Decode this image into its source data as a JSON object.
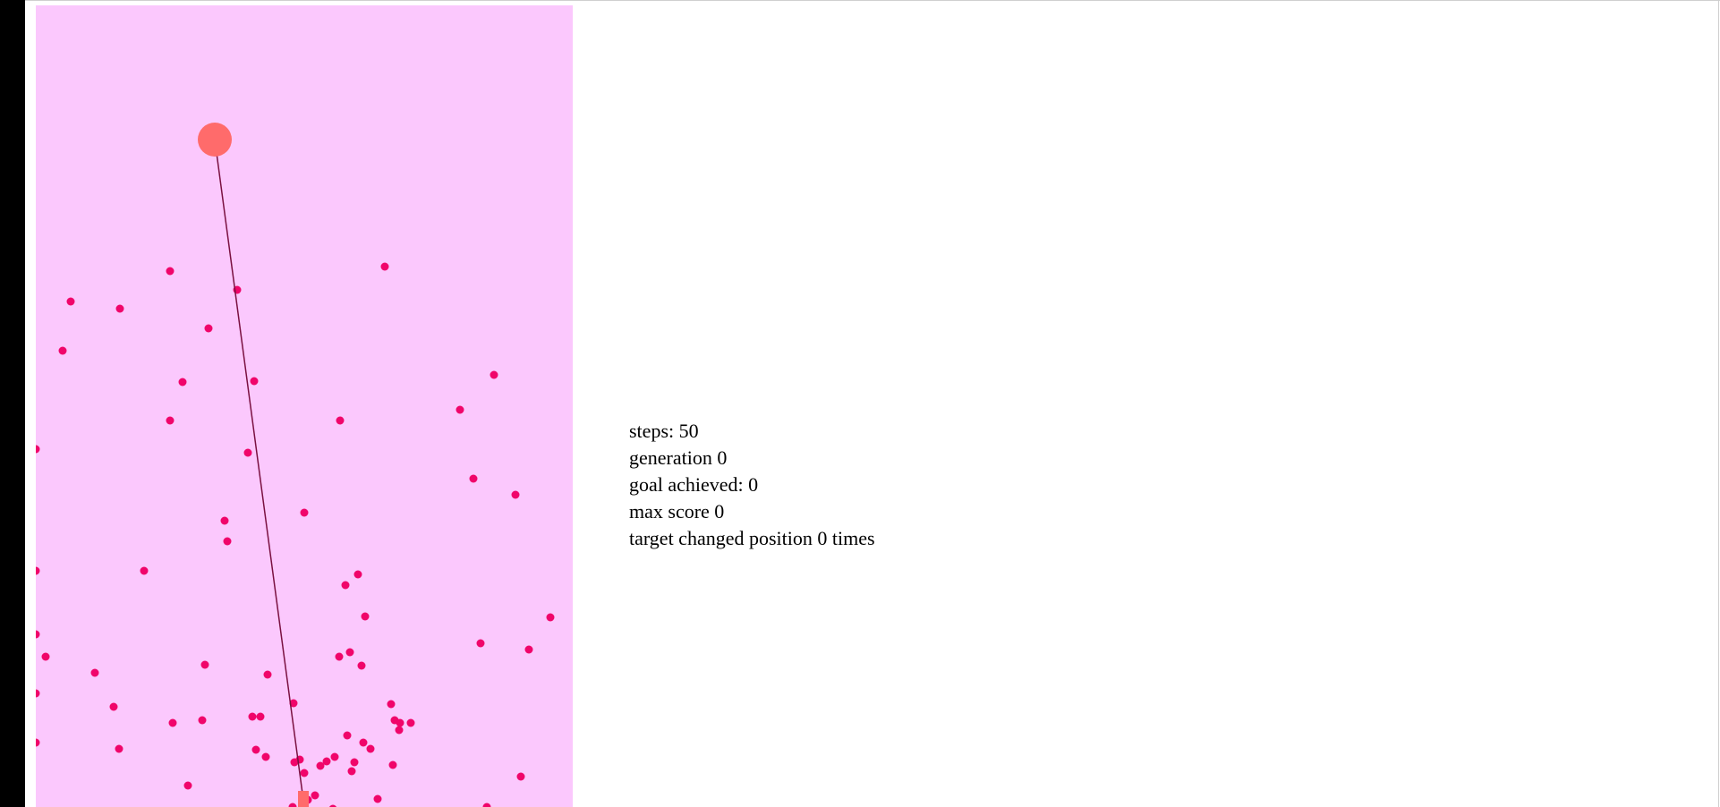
{
  "stats": {
    "steps": "steps: 50",
    "generation": "generation 0",
    "goal_achieved": "goal achieved: 0",
    "max_score": "max score 0",
    "target_changed": "target changed position 0 times"
  },
  "colors": {
    "canvas_background": "#fbc8fd",
    "dot": "#f0056a",
    "goal": "#ff6b6b",
    "path_line": "#7a1040",
    "page_background": "#ffffff",
    "left_bar": "#000000"
  },
  "icons": {
    "goal": "goal-target-icon",
    "dot": "agent-dot-icon",
    "start": "start-marker-icon"
  }
}
